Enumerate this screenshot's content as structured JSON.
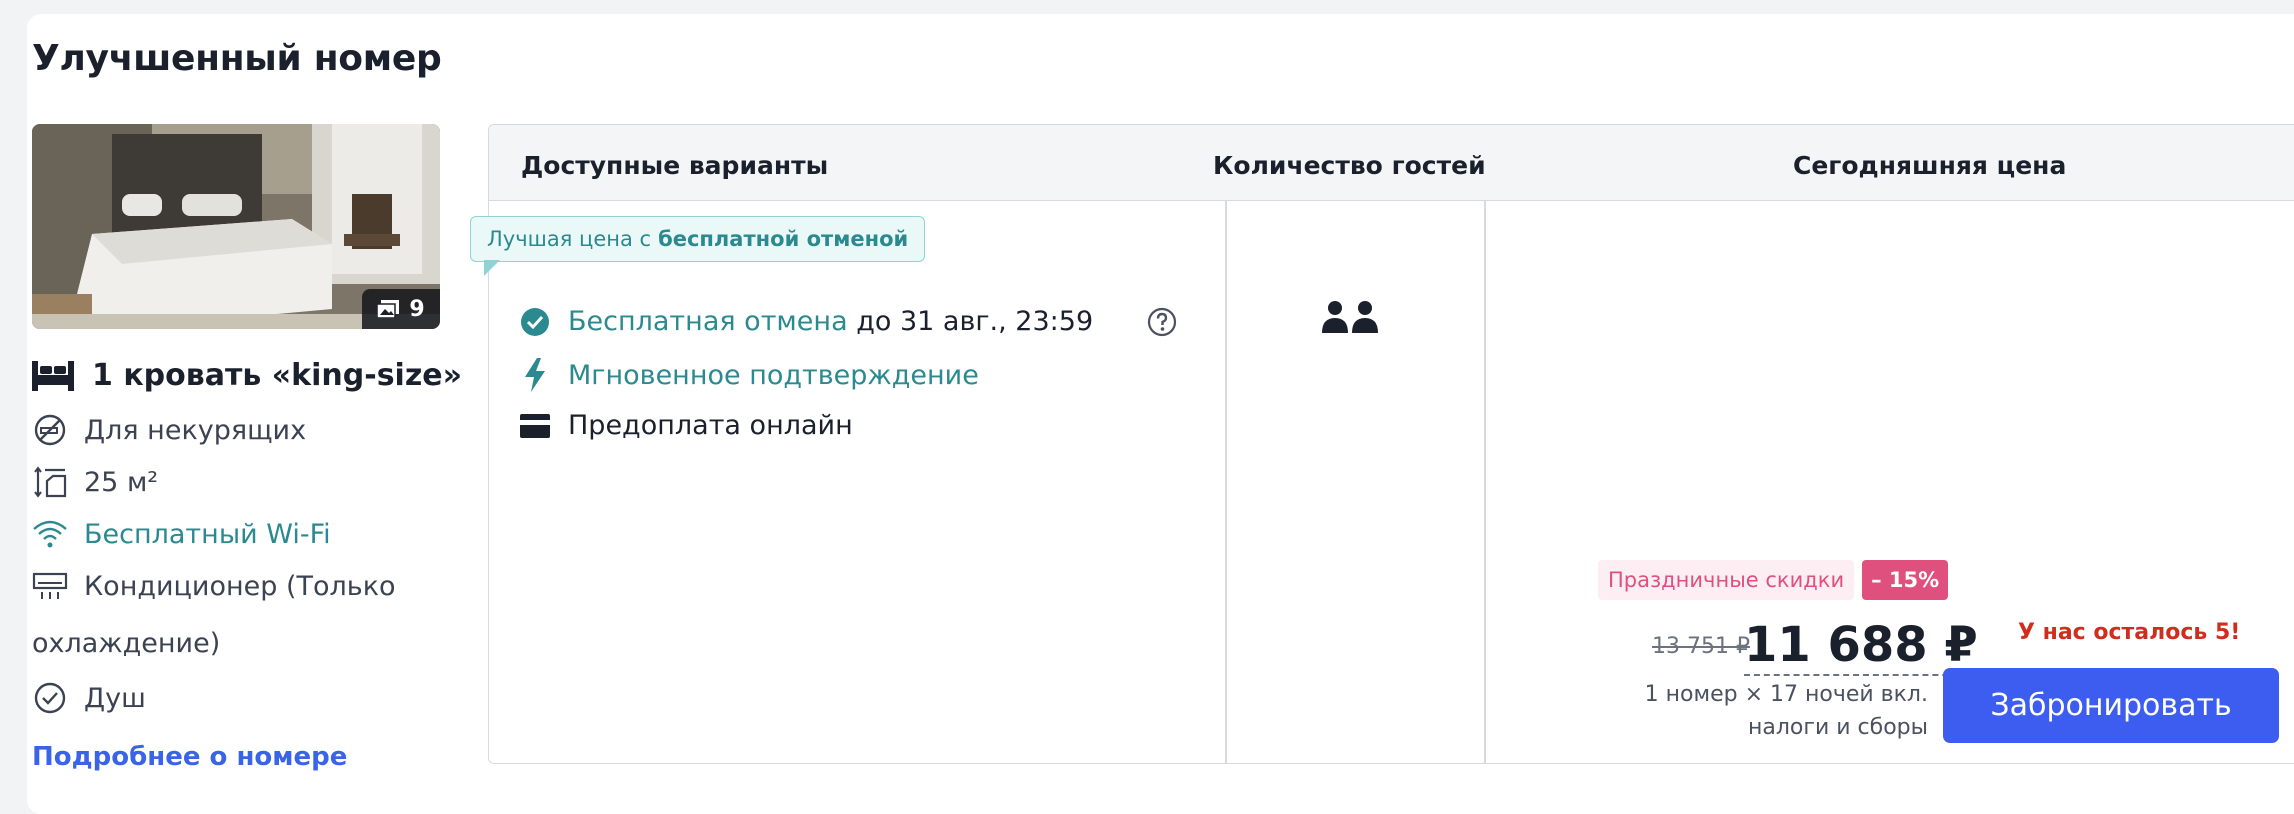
{
  "room": {
    "title": "Улучшенный номер",
    "photo_count": "9",
    "bed": "1 кровать «king-size»",
    "features": [
      {
        "label": "Для некурящих",
        "icon": "no-smoking-icon"
      },
      {
        "label": "25 м²",
        "icon": "room-size-icon"
      },
      {
        "label": "Бесплатный Wi-Fi",
        "icon": "wifi-icon"
      },
      {
        "label": "Кондиционер (Только",
        "icon": "air-conditioner-icon"
      },
      {
        "label": "Душ",
        "icon": "check-circle-icon"
      }
    ],
    "feature_continuation": "охлаждение)",
    "more_link": "Подробнее о номере"
  },
  "table": {
    "headers": [
      "Доступные варианты",
      "Количество гостей",
      "Сегодняшняя цена"
    ],
    "best_badge": {
      "prefix": "Лучшая цена с",
      "bold": "бесплатной отменой"
    },
    "options": [
      {
        "highlight": "Бесплатная отмена",
        "rest": " до 31 авг., 23:59",
        "icon": "check-circle-icon"
      },
      {
        "highlight": "Мгновенное подтверждение",
        "rest": "",
        "icon": "lightning-icon"
      },
      {
        "highlight": "",
        "rest": "Предоплата онлайн",
        "icon": "card-icon"
      }
    ],
    "guests": "2"
  },
  "price": {
    "promo_label": "Праздничные скидки",
    "promo_discount": "– 15%",
    "old_price": "13 751 ₽",
    "new_price": "11 688 ₽",
    "note": "1 номер × 17 ночей вкл. налоги и сборы",
    "rooms_left": "У нас осталось 5!",
    "book_button": "Забронировать"
  },
  "colors": {
    "accent_teal": "#2b8a8f",
    "link_blue": "#3a64e8",
    "button_blue": "#3d5df0",
    "promo_pink": "#e0507e",
    "alert_red": "#d12d1e"
  }
}
